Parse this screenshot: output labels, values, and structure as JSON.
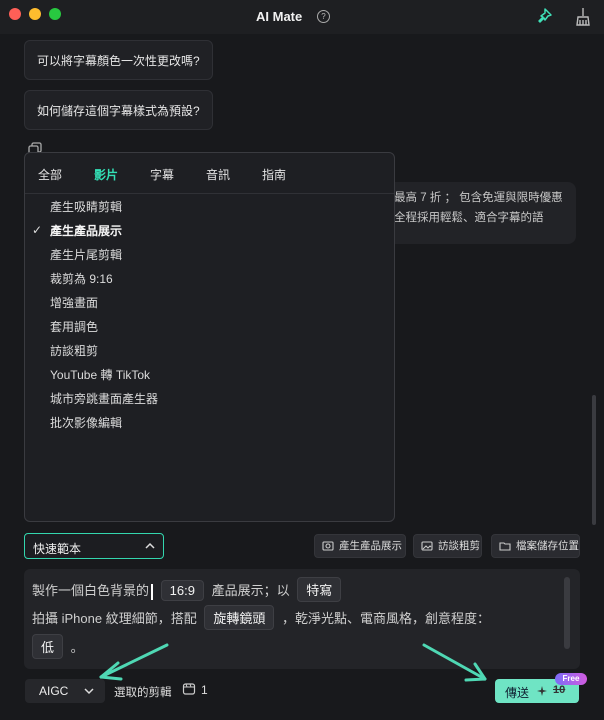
{
  "window": {
    "title": "AI Mate"
  },
  "suggestions": [
    "可以將字幕顏色一次性更改嗎?",
    "如何儲存這個字幕樣式為預設?"
  ],
  "answer_lines": [
    "最高 7 折 ； 包含免運與限時優惠",
    "全程採用輕鬆、適合字幕的語"
  ],
  "dropdown": {
    "tabs": [
      "全部",
      "影片",
      "字幕",
      "音訊",
      "指南"
    ],
    "active_tab": "影片",
    "items": [
      "產生吸睛剪輯",
      "產生產品展示",
      "產生片尾剪輯",
      "裁剪為 9:16",
      "增強畫面",
      "套用調色",
      "訪談粗剪",
      "YouTube 轉 TikTok",
      "城市旁跳畫面產生器",
      "批次影像編輯"
    ],
    "selected_item": "產生產品展示"
  },
  "quick_template": {
    "label": "快速範本"
  },
  "shortcut_buttons": [
    "產生產品展示",
    "訪談粗剪",
    "檔案儲存位置"
  ],
  "composer": {
    "line1_prefix": "製作一個白色背景的",
    "line1_tag1": "16:9",
    "line1_mid": "產品展示；以",
    "line1_tag2": "特寫",
    "line2_prefix": "拍攝 iPhone 紋理細節，搭配",
    "line2_tag": "旋轉鏡頭",
    "line2_suffix": "，乾淨光點、電商風格，創意程度：",
    "line3_tag": "低",
    "line3_suffix": "。"
  },
  "footer": {
    "model": "AIGC",
    "selected_clip_label": "選取的剪輯",
    "clip_count": "1",
    "send_label": "傳送",
    "credit_cost": "10",
    "free_badge": "Free"
  },
  "colors": {
    "accent": "#33e0b6",
    "send_button": "#6fe4c4",
    "arrow": "#4fd8b4"
  },
  "icons": [
    "help-icon",
    "pin-icon",
    "broom-icon",
    "copy-icon",
    "check-icon",
    "chevron-up-icon",
    "chevron-down-icon",
    "clip-icon",
    "spark-icon"
  ]
}
